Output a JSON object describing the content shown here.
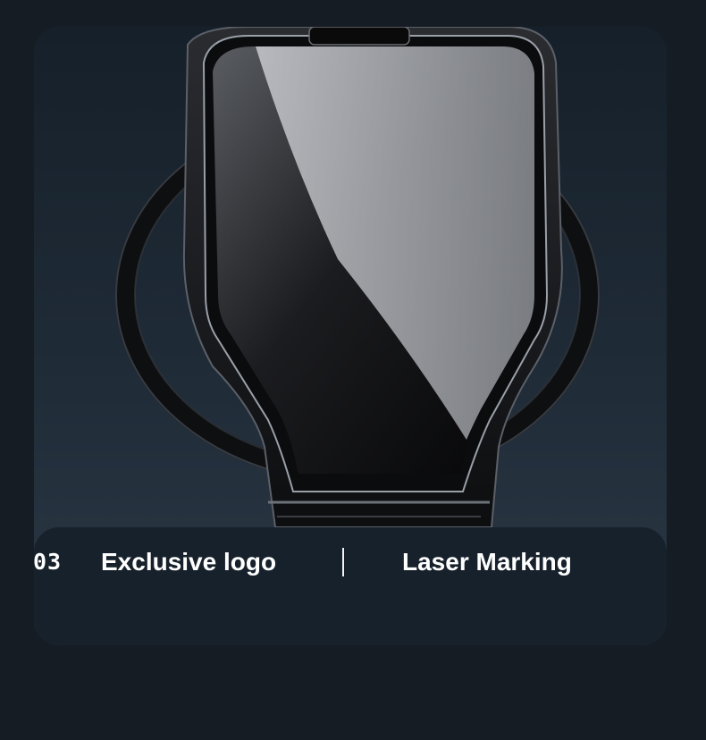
{
  "colors": {
    "page_background": "#161c23",
    "panel_background": "#17212b",
    "text": "#ffffff"
  },
  "product": {
    "icon": "phone-holder-image"
  },
  "caption": {
    "number": "03",
    "title": "Exclusive logo",
    "subtitle": "Laser Marking"
  }
}
